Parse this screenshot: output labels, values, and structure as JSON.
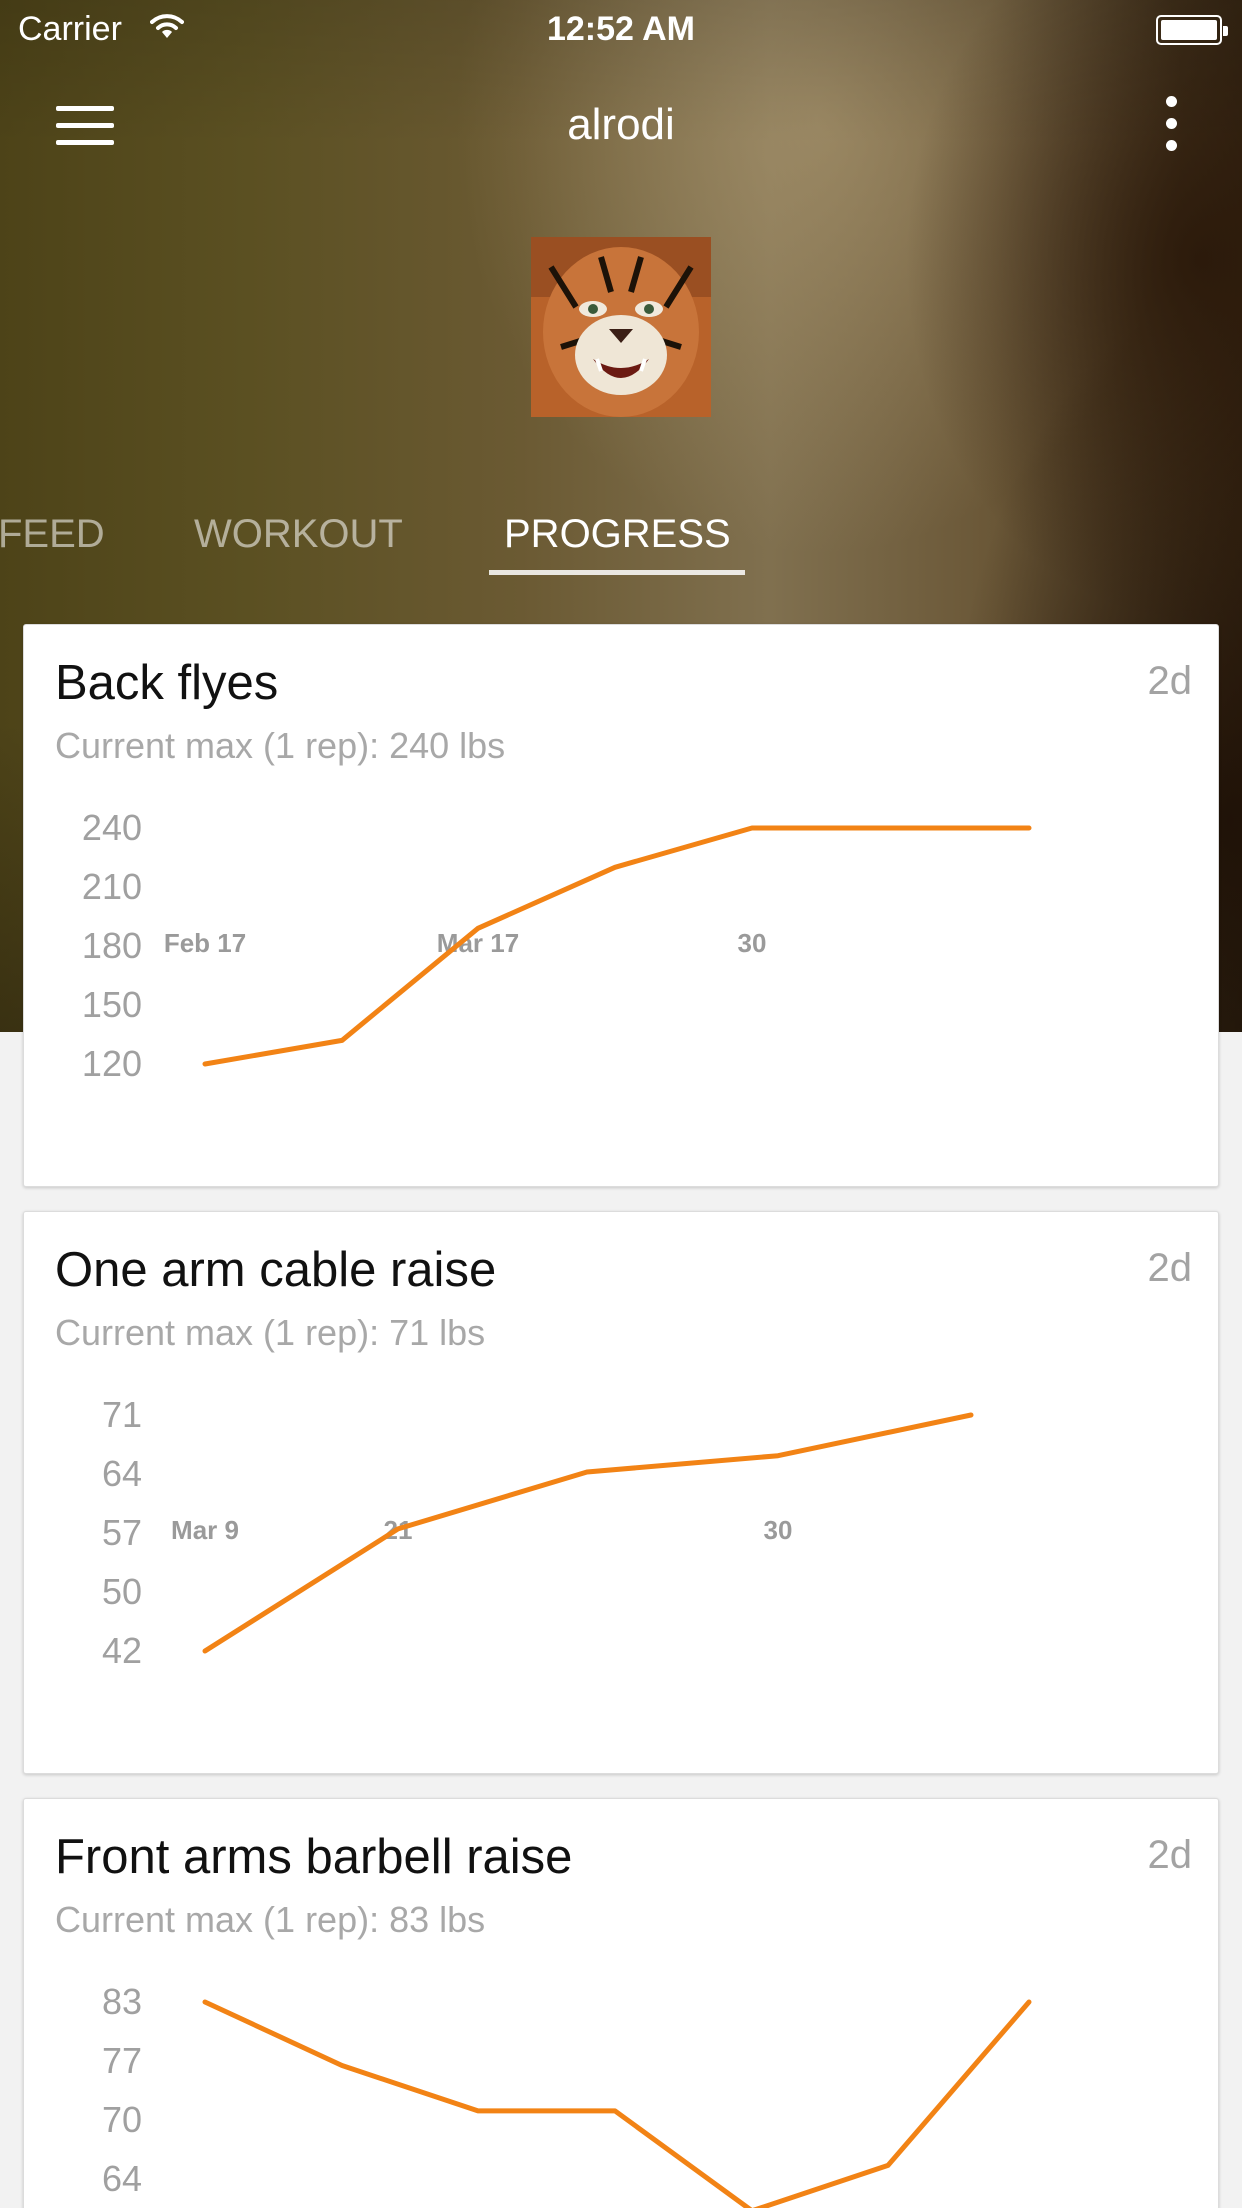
{
  "status_bar": {
    "carrier": "Carrier",
    "time": "12:52 AM"
  },
  "header": {
    "title": "alrodi"
  },
  "tabs": [
    {
      "label": "FEED",
      "active": false
    },
    {
      "label": "WORKOUT",
      "active": false
    },
    {
      "label": "PROGRESS",
      "active": true
    }
  ],
  "accent_color": "#f28315",
  "cards": [
    {
      "title": "Back flyes",
      "age": "2d",
      "subtitle": "Current max (1 rep): 240 lbs",
      "chart_data": {
        "type": "line",
        "yticks": [
          "240",
          "210",
          "180",
          "150",
          "120"
        ],
        "ylim": [
          120,
          240
        ],
        "xticks": [
          "Feb 17",
          "Mar 17",
          "30"
        ],
        "values": [
          120,
          132,
          189,
          220,
          240,
          240,
          240
        ]
      }
    },
    {
      "title": "One arm cable raise",
      "age": "2d",
      "subtitle": "Current max (1 rep): 71 lbs",
      "chart_data": {
        "type": "line",
        "yticks": [
          "71",
          "64",
          "57",
          "50",
          "42"
        ],
        "ylim": [
          42,
          71
        ],
        "xticks": [
          "Mar 9",
          "21",
          "30"
        ],
        "values": [
          42,
          57,
          64,
          66,
          71
        ]
      }
    },
    {
      "title": "Front arms barbell raise",
      "age": "2d",
      "subtitle": "Current max (1 rep): 83 lbs",
      "chart_data": {
        "type": "line",
        "yticks": [
          "83",
          "77",
          "70",
          "64"
        ],
        "ylim": [
          64,
          83
        ],
        "xticks": [],
        "values": [
          83,
          76,
          71,
          71,
          60,
          65,
          83
        ]
      }
    }
  ]
}
